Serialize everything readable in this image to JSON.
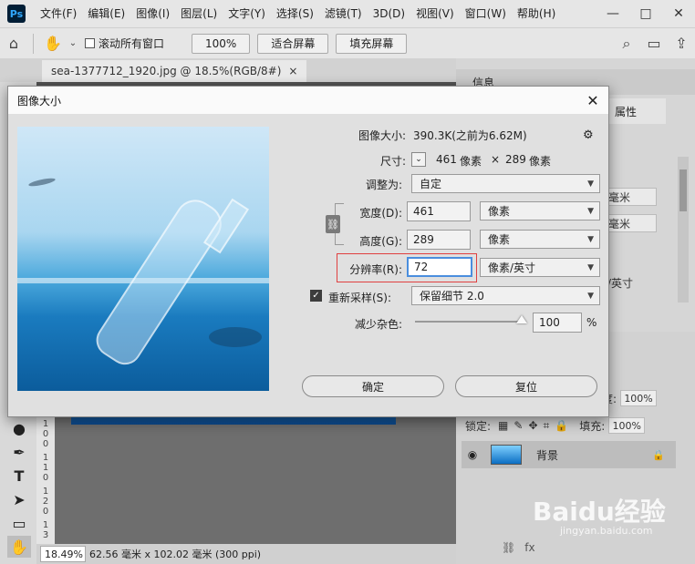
{
  "app": {
    "logo": "Ps",
    "menu": [
      "文件(F)",
      "编辑(E)",
      "图像(I)",
      "图层(L)",
      "文字(Y)",
      "选择(S)",
      "滤镜(T)",
      "3D(D)",
      "视图(V)",
      "窗口(W)",
      "帮助(H)"
    ],
    "window_controls": [
      "—",
      "□",
      "✕"
    ]
  },
  "options_bar": {
    "scroll_all_label": "滚动所有窗口",
    "zoom_100": "100%",
    "fit_screen": "适合屏幕",
    "fill_screen": "填充屏幕"
  },
  "document": {
    "tab_label": "sea-1377712_1920.jpg @ 18.5%(RGB/8#)",
    "tab_close": "×",
    "ruler_labels": [
      "1",
      "0",
      "0",
      "1",
      "1",
      "0",
      "1",
      "2",
      "0",
      "1",
      "3",
      "0"
    ],
    "status_zoom": "18.49%",
    "status_info": "62.56 毫米 x 102.02 毫米 (300 ppi)"
  },
  "right_panel": {
    "info_tab": "信息",
    "properties_tab": "属性",
    "prop_unit_1": "毫米",
    "prop_unit_2": "毫米",
    "prop_ppi": "/英寸",
    "opacity_label": "度:",
    "opacity_value": "100%",
    "lock_label": "锁定:",
    "fill_label": "填充:",
    "fill_value": "100%",
    "layer_name": "背景",
    "footer_fx": "fx"
  },
  "dialog": {
    "title": "图像大小",
    "close": "✕",
    "image_size_label": "图像大小:",
    "image_size_value": "390.3K(之前为6.62M)",
    "dimension_label": "尺寸:",
    "dimension_width": "461",
    "dimension_unit_w": "像素",
    "dimension_times": "×",
    "dimension_height": "289",
    "dimension_unit_h": "像素",
    "fit_to_label": "调整为:",
    "fit_to_value": "自定",
    "width_label": "宽度(D):",
    "width_value": "461",
    "width_unit": "像素",
    "height_label": "高度(G):",
    "height_value": "289",
    "height_unit": "像素",
    "resolution_label": "分辨率(R):",
    "resolution_value": "72",
    "resolution_unit": "像素/英寸",
    "resample_label": "重新采样(S):",
    "resample_value": "保留细节 2.0",
    "noise_label": "减少杂色:",
    "noise_value": "100",
    "noise_unit": "%",
    "ok_label": "确定",
    "reset_label": "复位"
  },
  "watermark": {
    "brand": "Baidu经验",
    "url": "jingyan.baidu.com"
  }
}
